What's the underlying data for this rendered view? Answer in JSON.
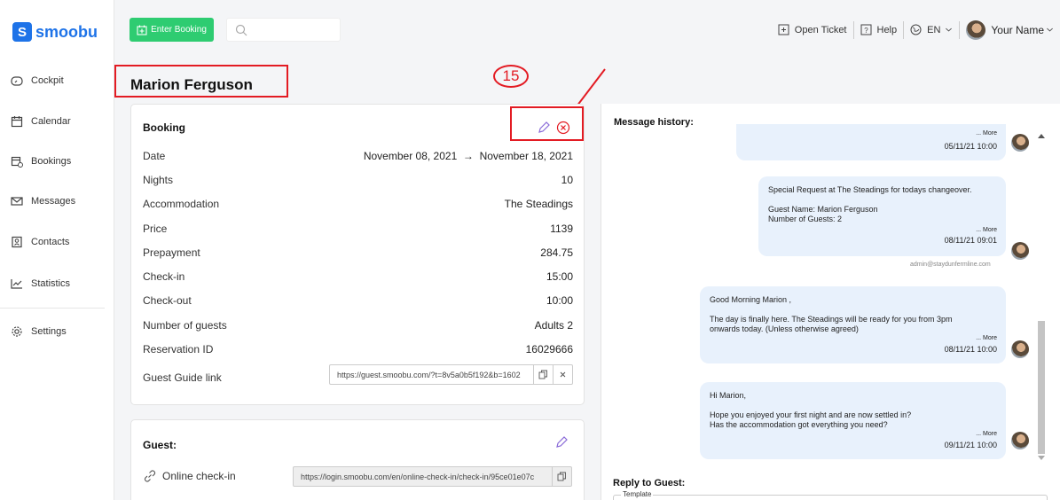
{
  "brand": {
    "name": "smoobu",
    "mark": "S"
  },
  "sidebar": {
    "items": [
      {
        "label": "Cockpit",
        "icon": "cockpit-icon"
      },
      {
        "label": "Calendar",
        "icon": "calendar-icon"
      },
      {
        "label": "Bookings",
        "icon": "bookings-icon"
      },
      {
        "label": "Messages",
        "icon": "mail-icon"
      },
      {
        "label": "Contacts",
        "icon": "contacts-icon"
      },
      {
        "label": "Statistics",
        "icon": "statistics-icon"
      },
      {
        "label": "Settings",
        "icon": "gear-icon"
      }
    ]
  },
  "topbar": {
    "enter_booking": "Enter Booking",
    "search_placeholder": "",
    "open_ticket": "Open Ticket",
    "help": "Help",
    "language": "EN",
    "user_name": "Your Name"
  },
  "page": {
    "title": "Marion Ferguson"
  },
  "annotation": {
    "number": "15",
    "color": "#e31b23"
  },
  "booking": {
    "title": "Booking",
    "date_from": "November 08, 2021",
    "arrow": "→",
    "date_to": "November 18, 2021",
    "rows": [
      {
        "label": "Date",
        "value": ""
      },
      {
        "label": "Nights",
        "value": "10"
      },
      {
        "label": "Accommodation",
        "value": "The Steadings"
      },
      {
        "label": "Price",
        "value": "1139"
      },
      {
        "label": "Prepayment",
        "value": "284.75"
      },
      {
        "label": "Check-in",
        "value": "15:00"
      },
      {
        "label": "Check-out",
        "value": "10:00"
      },
      {
        "label": "Number of guests",
        "value": "Adults 2"
      },
      {
        "label": "Reservation ID",
        "value": "16029666"
      }
    ],
    "guest_guide_label": "Guest Guide link",
    "guest_guide_url": "https://guest.smoobu.com/?t=8v5a0b5f192&b=1602"
  },
  "guest": {
    "title": "Guest:",
    "online_checkin_label": "Online check-in",
    "online_checkin_url": "https://login.smoobu.com/en/online-check-in/check-in/95ce01e07c"
  },
  "messages": {
    "title": "Message history:",
    "more": "... More",
    "items": [
      {
        "body": "",
        "time": "05/11/21 10:00"
      },
      {
        "body": "Special Request at The Steadings for todays changeover.\n\nGuest Name: Marion Ferguson\nNumber of Guests: 2",
        "time": "08/11/21 09:01",
        "sender": "admin@staydunfermline.com"
      },
      {
        "body": "Good Morning Marion ,\n\nThe day is finally here. The Steadings will be ready for you from 3pm\nonwards today. (Unless otherwise agreed)",
        "time": "08/11/21 10:00"
      },
      {
        "body": "Hi Marion,\n\nHope you enjoyed your first night and are now settled in?\nHas the accommodation got everything you need?",
        "time": "09/11/21 10:00"
      }
    ],
    "reply_title": "Reply to Guest:",
    "template_label": "Template"
  },
  "colors": {
    "primary": "#1e73e8",
    "success": "#2ecc71",
    "bubble": "#e8f1fc",
    "annotation": "#e31b23"
  }
}
